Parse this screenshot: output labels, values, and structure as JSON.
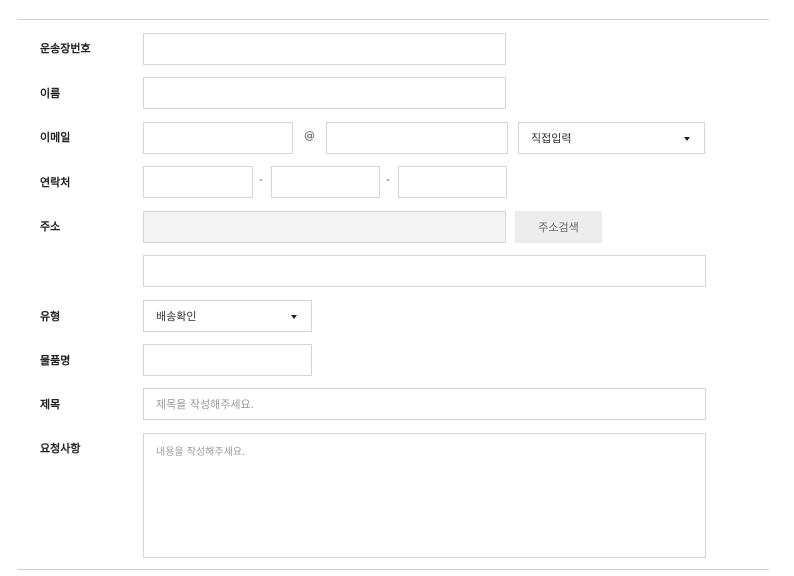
{
  "form": {
    "tracking_number": {
      "label": "운송장번호",
      "value": ""
    },
    "name": {
      "label": "이름",
      "value": ""
    },
    "email": {
      "label": "이메일",
      "local_value": "",
      "at_sign": "@",
      "domain_value": "",
      "domain_select": "직접입력"
    },
    "phone": {
      "label": "연락처",
      "part1": "",
      "part2": "",
      "part3": "",
      "separator": "-"
    },
    "address": {
      "label": "주소",
      "main_value": "",
      "detail_value": "",
      "search_button": "주소검색"
    },
    "type": {
      "label": "유형",
      "selected": "배송확인"
    },
    "product": {
      "label": "물품명",
      "value": ""
    },
    "subject": {
      "label": "제목",
      "placeholder": "제목을 작성해주세요."
    },
    "request": {
      "label": "요청사항",
      "placeholder": "내용을 작성해주세요."
    }
  },
  "icons": {
    "dropdown": "caret-down-icon"
  }
}
